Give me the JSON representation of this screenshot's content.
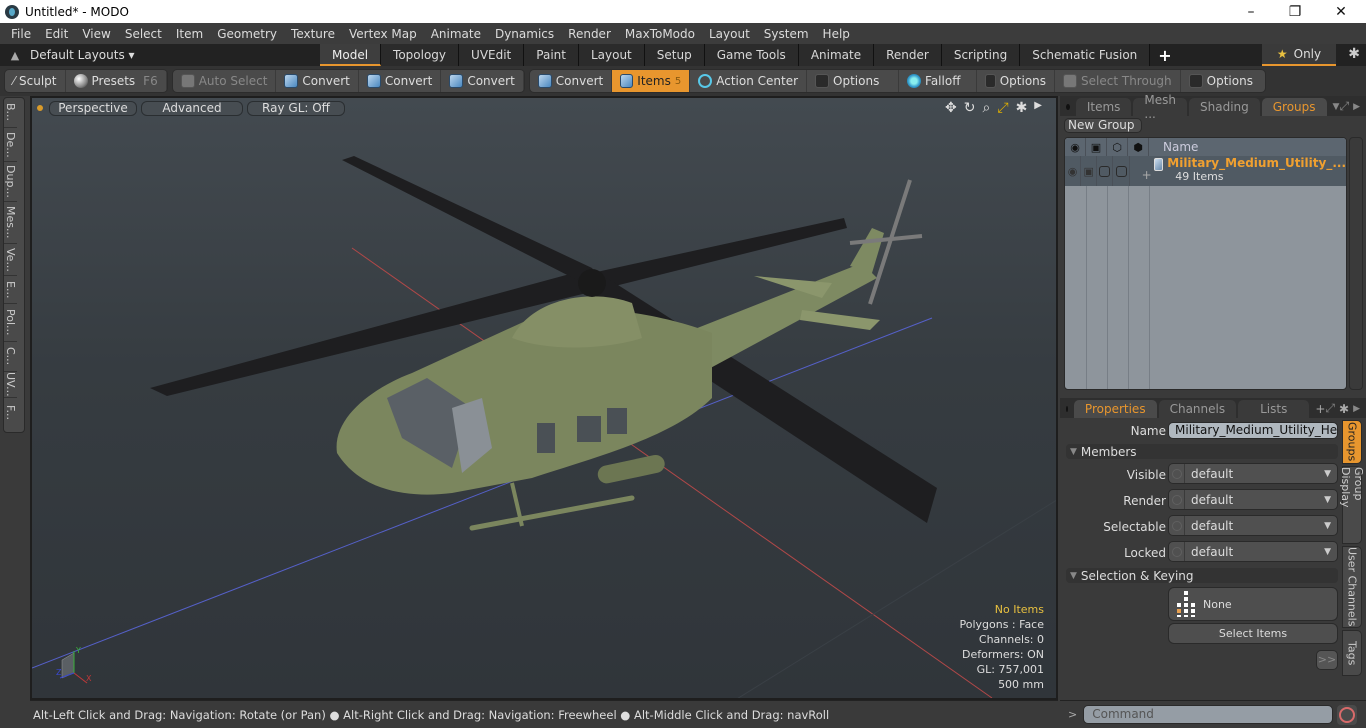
{
  "window": {
    "title": "Untitled* - MODO",
    "minimize": "–",
    "restore": "❐",
    "close": "✕"
  },
  "menu": [
    "File",
    "Edit",
    "View",
    "Select",
    "Item",
    "Geometry",
    "Texture",
    "Vertex Map",
    "Animate",
    "Dynamics",
    "Render",
    "MaxToModo",
    "Layout",
    "System",
    "Help"
  ],
  "layouts": {
    "label": "Default Layouts ▾",
    "tabs": [
      "Model",
      "Topology",
      "UVEdit",
      "Paint",
      "Layout",
      "Setup",
      "Game Tools",
      "Animate",
      "Render",
      "Scripting",
      "Schematic Fusion"
    ],
    "active_tab": "Model",
    "add": "+",
    "only_label": "Only",
    "star": "★",
    "gear": "✱"
  },
  "toolbar": {
    "sculpt": "Sculpt",
    "presets": "Presets",
    "presets_key": "F6",
    "auto_select": "Auto Select",
    "convert1": "Convert",
    "convert2": "Convert",
    "convert3": "Convert",
    "convert4": "Convert",
    "items": "Items",
    "items_badge": "5",
    "action_center": "Action Center",
    "options1": "Options",
    "falloff": "Falloff",
    "options2": "Options",
    "select_through": "Select Through",
    "options3": "Options"
  },
  "left_tabs": [
    "B...",
    "De...",
    "Dup...",
    "Mes...",
    "Ve...",
    "E...",
    "Pol...",
    "C...",
    "UV...",
    "F..."
  ],
  "viewport": {
    "view_mode": "Perspective",
    "shading": "Advanced",
    "raygl": "Ray GL: Off",
    "icons": [
      "move-icon",
      "rotate-icon",
      "zoom-icon",
      "fit-icon",
      "gear-icon",
      "more-icon"
    ],
    "info": {
      "selection": "No Items",
      "polygons": "Polygons : Face",
      "channels": "Channels: 0",
      "deformers": "Deformers: ON",
      "gl": "GL: 757,001",
      "scale": "500 mm"
    },
    "axis": {
      "x": "X",
      "y": "Y",
      "z": "Z"
    }
  },
  "status": {
    "hint": "Alt-Left Click and Drag: Navigation: Rotate (or Pan) ● Alt-Right Click and Drag: Navigation: Freewheel ● Alt-Middle Click and Drag: navRoll"
  },
  "top_panel": {
    "tabs": [
      "Items",
      "Mesh ...",
      "Shading",
      "Groups"
    ],
    "active_tab": "Groups",
    "new_group": "New Group",
    "list_header": "Name",
    "group": {
      "name": "Military_Medium_Utility_...",
      "count": "49 Items"
    }
  },
  "properties": {
    "tabs": [
      "Properties",
      "Channels",
      "Lists"
    ],
    "active_tab": "Properties",
    "add": "+",
    "name_label": "Name",
    "name_value": "Military_Medium_Utility_Helicopte",
    "members_label": "Members",
    "members": [
      {
        "label": "Visible",
        "value": "default"
      },
      {
        "label": "Render",
        "value": "default"
      },
      {
        "label": "Selectable",
        "value": "default"
      },
      {
        "label": "Locked",
        "value": "default"
      }
    ],
    "sel_keying_label": "Selection & Keying",
    "none_label": "None",
    "select_items": "Select Items",
    "more": ">>"
  },
  "side_tabs": [
    "Groups",
    "Group Display",
    "User Channels",
    "Tags"
  ],
  "command": {
    "prompt": ">",
    "placeholder": "Command"
  }
}
